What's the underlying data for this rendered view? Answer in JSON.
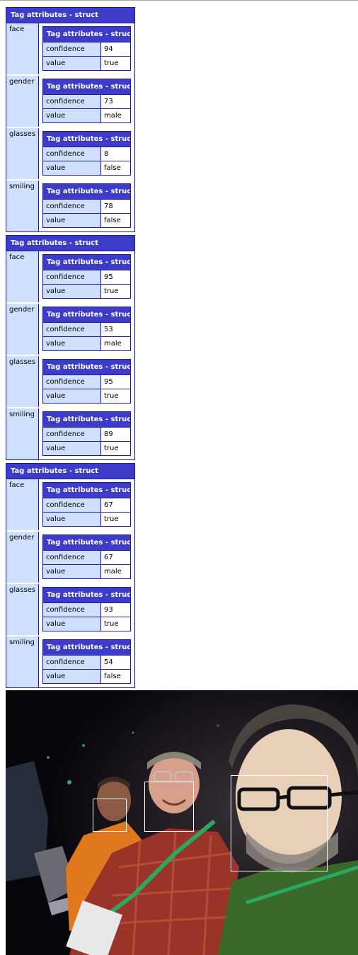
{
  "header_label": "Tag attributes - struct",
  "attr_keys": {
    "confidence": "confidence",
    "value": "value"
  },
  "tags": [
    {
      "face": {
        "confidence": "94",
        "value": "true"
      },
      "gender": {
        "confidence": "73",
        "value": "male"
      },
      "glasses": {
        "confidence": "8",
        "value": "false"
      },
      "smiling": {
        "confidence": "78",
        "value": "false"
      }
    },
    {
      "face": {
        "confidence": "95",
        "value": "true"
      },
      "gender": {
        "confidence": "53",
        "value": "male"
      },
      "glasses": {
        "confidence": "95",
        "value": "true"
      },
      "smiling": {
        "confidence": "89",
        "value": "true"
      }
    },
    {
      "face": {
        "confidence": "67",
        "value": "true"
      },
      "gender": {
        "confidence": "67",
        "value": "male"
      },
      "glasses": {
        "confidence": "93",
        "value": "true"
      },
      "smiling": {
        "confidence": "54",
        "value": "false"
      }
    }
  ],
  "attribute_names": [
    "face",
    "gender",
    "glasses",
    "smiling"
  ],
  "colors": {
    "header_bg": "#3c3cc8",
    "border": "#1c1c9c",
    "key_bg": "#cfe0ff"
  }
}
